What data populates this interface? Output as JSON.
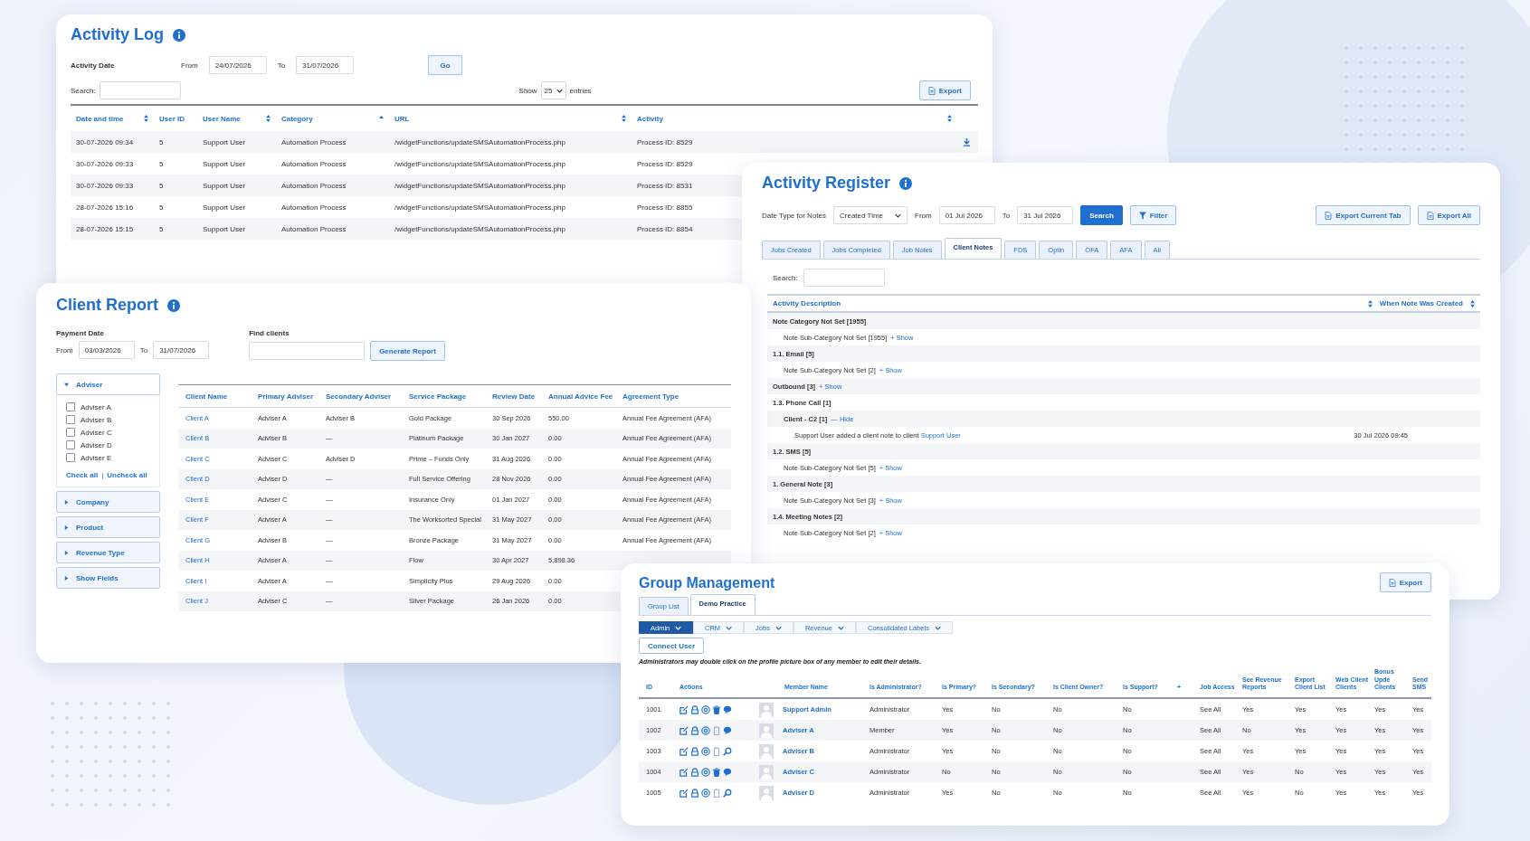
{
  "activity_log": {
    "title": "Activity Log",
    "date_label": "Activity Date",
    "from_label": "From",
    "from": "24/07/2026",
    "to_label": "To",
    "to": "31/07/2026",
    "go": "Go",
    "search_label": "Search:",
    "show_label": "Show",
    "show_value": "25",
    "entries_label": "entries",
    "export": "Export",
    "columns": [
      {
        "label": "Date and time",
        "kind": "sortable"
      },
      {
        "label": "User ID",
        "kind": "plain"
      },
      {
        "label": "User Name",
        "kind": "sortable"
      },
      {
        "label": "Category",
        "kind": "sorted"
      },
      {
        "label": "URL",
        "kind": "sortable"
      },
      {
        "label": "Activity",
        "kind": "sortable"
      }
    ],
    "rows": [
      {
        "cells": [
          "30-07-2026 09:34",
          "5",
          "Support User",
          "Automation Process",
          "/widgetFunctions/updateSMSAutomationProcess.php",
          "Process ID: 8529"
        ]
      },
      {
        "cells": [
          "30-07-2026 09:33",
          "5",
          "Support User",
          "Automation Process",
          "/widgetFunctions/updateSMSAutomationProcess.php",
          "Process ID: 8529"
        ]
      },
      {
        "cells": [
          "30-07-2026 09:33",
          "5",
          "Support User",
          "Automation Process",
          "/widgetFunctions/updateSMSAutomationProcess.php",
          "Process ID: 8531"
        ]
      },
      {
        "cells": [
          "28-07-2026 15:16",
          "5",
          "Support User",
          "Automation Process",
          "/widgetFunctions/updateSMSAutomationProcess.php",
          "Process ID: 8855"
        ]
      },
      {
        "cells": [
          "28-07-2026 15:15",
          "5",
          "Support User",
          "Automation Process",
          "/widgetFunctions/updateSMSAutomationProcess.php",
          "Process ID: 8854"
        ]
      }
    ]
  },
  "activity_register": {
    "title": "Activity Register",
    "date_type_label": "Date Type for Notes",
    "date_type": "Created Time",
    "from_label": "From",
    "from": "01 Jul 2026",
    "to_label": "To",
    "to": "31 Jul 2026",
    "search": "Search",
    "filter": "Filter",
    "export_current": "Export Current Tab",
    "export_all": "Export All",
    "tabs": [
      {
        "label": "Jobs Created",
        "selected": false
      },
      {
        "label": "Jobs Completed",
        "selected": false
      },
      {
        "label": "Job Notes",
        "selected": false
      },
      {
        "label": "Client Notes",
        "selected": true
      },
      {
        "label": "FDS",
        "selected": false
      },
      {
        "label": "Optin",
        "selected": false
      },
      {
        "label": "OFA",
        "selected": false
      },
      {
        "label": "AFA",
        "selected": false
      },
      {
        "label": "All",
        "selected": false
      }
    ],
    "search_label": "Search:",
    "columns": [
      "Activity Description",
      "When Note Was Created"
    ],
    "notes": [
      {
        "kind": "category",
        "label": "Note Category Not Set [1955]",
        "children": [
          {
            "kind": "subcategory",
            "label": "Note Sub-Category Not Set [1955]",
            "toggle": "+ Show"
          }
        ]
      },
      {
        "kind": "category",
        "label": "1.1. Email [5]",
        "children": [
          {
            "kind": "subcategory",
            "label": "Note Sub-Category Not Set [2]",
            "toggle": "+ Show"
          }
        ]
      },
      {
        "kind": "category",
        "label": "Outbound [3]",
        "toggle": "+ Show"
      },
      {
        "kind": "category",
        "label": "1.3. Phone Call [1]",
        "children": [
          {
            "kind": "subcategory",
            "label": "Client - C2 [1]",
            "toggle": "— Hide",
            "children": [
              {
                "kind": "note",
                "text": "Support User added a client note to client",
                "link": "Support User",
                "date": "30 Jul 2026 09:45"
              }
            ]
          }
        ]
      },
      {
        "kind": "category",
        "label": "1.2. SMS [5]",
        "children": [
          {
            "kind": "subcategory",
            "label": "Note Sub-Category Not Set [5]",
            "toggle": "+ Show"
          }
        ]
      },
      {
        "kind": "category",
        "label": "1. General Note [3]",
        "children": [
          {
            "kind": "subcategory",
            "label": "Note Sub-Category Not Set [3]",
            "toggle": "+ Show"
          }
        ]
      },
      {
        "kind": "category",
        "label": "1.4. Meeting Notes [2]",
        "children": [
          {
            "kind": "subcategory",
            "label": "Note Sub-Category Not Set [2]",
            "toggle": "+ Show"
          }
        ]
      }
    ]
  },
  "client_report": {
    "title": "Client Report",
    "payment_date_label": "Payment Date",
    "from_label": "From",
    "from": "03/03/2026",
    "to_label": "To",
    "to": "31/07/2026",
    "find_label": "Find clients",
    "generate": "Generate Report",
    "filters": [
      {
        "label": "Adviser",
        "expanded": true,
        "options": [
          {
            "label": "Adviser A",
            "checked": false
          },
          {
            "label": "Adviser B",
            "checked": false
          },
          {
            "label": "Adviser C",
            "checked": false
          },
          {
            "label": "Adviser D",
            "checked": false
          },
          {
            "label": "Adviser E",
            "checked": false
          }
        ],
        "links": [
          "Check all",
          "Uncheck all"
        ],
        "link_separator": "|"
      },
      {
        "label": "Company",
        "expanded": false
      },
      {
        "label": "Product",
        "expanded": false
      },
      {
        "label": "Revenue Type",
        "expanded": false
      },
      {
        "label": "Show Fields",
        "expanded": false
      }
    ],
    "columns": [
      "Client Name",
      "Primary Adviser",
      "Secondary Adviser",
      "Service Package",
      "Review Date",
      "Annual Advice Fee",
      "Agreement Type"
    ],
    "rows": [
      {
        "cells": [
          "Client A",
          "Adviser A",
          "Adviser B",
          "Gold Package",
          "30 Sep 2026",
          "550.00",
          "Annual Fee Agreement (AFA)"
        ]
      },
      {
        "cells": [
          "Client B",
          "Adviser B",
          "—",
          "Platinum Package",
          "30 Jan 2027",
          "0.00",
          "Annual Fee Agreement (AFA)"
        ]
      },
      {
        "cells": [
          "Client C",
          "Adviser C",
          "Adviser D",
          "Prime – Funds Only",
          "31 Aug 2026",
          "0.00",
          "Annual Fee Agreement (AFA)"
        ]
      },
      {
        "cells": [
          "Client D",
          "Adviser D",
          "—",
          "Full Service Offering",
          "28 Nov 2026",
          "0.00",
          "Annual Fee Agreement (AFA)"
        ]
      },
      {
        "cells": [
          "Client E",
          "Adviser C",
          "—",
          "Insurance Only",
          "01 Jan 2027",
          "0.00",
          "Annual Fee Agreement (AFA)"
        ]
      },
      {
        "cells": [
          "Client F",
          "Adviser A",
          "—",
          "The Worksorted Special",
          "31 May 2027",
          "0.00",
          "Annual Fee Agreement (AFA)"
        ]
      },
      {
        "cells": [
          "Client G",
          "Adviser B",
          "—",
          "Bronze Package",
          "31 May 2027",
          "0.00",
          "Annual Fee Agreement (AFA)"
        ]
      },
      {
        "cells": [
          "Client H",
          "Adviser A",
          "—",
          "Flow",
          "30 Apr 2027",
          "5,898.36"
        ]
      },
      {
        "cells": [
          "Client I",
          "Adviser A",
          "—",
          "Simplicity Plus",
          "29 Aug 2026",
          "0.00"
        ]
      },
      {
        "cells": [
          "Client J",
          "Adviser C",
          "—",
          "Silver Package",
          "26 Jan 2026",
          "0.00"
        ]
      }
    ]
  },
  "group_management": {
    "title": "Group Management",
    "export": "Export",
    "tabs": [
      {
        "label": "Group List",
        "selected": false
      },
      {
        "label": "Demo Practice",
        "selected": true
      }
    ],
    "menu": [
      {
        "label": "Admin",
        "selected": true
      },
      {
        "label": "CRM",
        "selected": false
      },
      {
        "label": "Jobs",
        "selected": false
      },
      {
        "label": "Revenue",
        "selected": false
      },
      {
        "label": "Consolidated Labels",
        "selected": false
      }
    ],
    "connect": "Connect User",
    "note": "Administrators may double click on the profile picture box of any member to edit their details.",
    "columns": [
      {
        "label": "ID"
      },
      {
        "label": "Actions"
      },
      {
        "label": "Member Name"
      },
      {
        "label": "Is Administrator?"
      },
      {
        "label": "Is Primary?"
      },
      {
        "label": "Is Secondary?"
      },
      {
        "label": "Is Client Owner?"
      },
      {
        "label": "Is Support?"
      },
      {
        "label": "+"
      },
      {
        "label": "Job Access"
      },
      {
        "label": "See Revenue Reports"
      },
      {
        "label": "Export Client List"
      },
      {
        "label": "Web Client Clients"
      },
      {
        "label": "Bonus Upde Clients"
      },
      {
        "label": "Send SMS"
      }
    ],
    "rows": [
      {
        "cells": [
          "1001",
          "",
          "Support Admin",
          "Administrator",
          "Yes",
          "No",
          "No",
          "No",
          "",
          "See All",
          "Yes",
          "Yes",
          "Yes",
          "Yes",
          "Yes"
        ],
        "actions": [
          {
            "kind": "edit"
          },
          {
            "kind": "lock"
          },
          {
            "kind": "at"
          },
          {
            "kind": "trash"
          },
          {
            "kind": "chat"
          }
        ]
      },
      {
        "cells": [
          "1002",
          "",
          "Adviser A",
          "Member",
          "Yes",
          "No",
          "No",
          "No",
          "",
          "See All",
          "No",
          "Yes",
          "Yes",
          "Yes",
          "Yes"
        ],
        "actions": [
          {
            "kind": "edit"
          },
          {
            "kind": "lock"
          },
          {
            "kind": "at"
          },
          {
            "kind": "clipboard"
          },
          {
            "kind": "chat"
          }
        ]
      },
      {
        "cells": [
          "1003",
          "",
          "Adviser B",
          "Administrator",
          "Yes",
          "No",
          "No",
          "No",
          "",
          "See All",
          "Yes",
          "Yes",
          "Yes",
          "Yes",
          "Yes"
        ],
        "actions": [
          {
            "kind": "edit"
          },
          {
            "kind": "lock"
          },
          {
            "kind": "at"
          },
          {
            "kind": "clipboard"
          },
          {
            "kind": "search"
          }
        ]
      },
      {
        "cells": [
          "1004",
          "",
          "Adviser C",
          "Administrator",
          "No",
          "No",
          "No",
          "No",
          "",
          "See All",
          "Yes",
          "No",
          "Yes",
          "Yes",
          "Yes"
        ],
        "actions": [
          {
            "kind": "edit"
          },
          {
            "kind": "lock"
          },
          {
            "kind": "at"
          },
          {
            "kind": "trash"
          },
          {
            "kind": "chat"
          }
        ]
      },
      {
        "cells": [
          "1005",
          "",
          "Adviser D",
          "Administrator",
          "Yes",
          "No",
          "No",
          "No",
          "",
          "See All",
          "Yes",
          "No",
          "Yes",
          "Yes",
          "Yes"
        ],
        "actions": [
          {
            "kind": "edit"
          },
          {
            "kind": "lock"
          },
          {
            "kind": "at"
          },
          {
            "kind": "clipboard"
          },
          {
            "kind": "search"
          }
        ]
      }
    ]
  }
}
